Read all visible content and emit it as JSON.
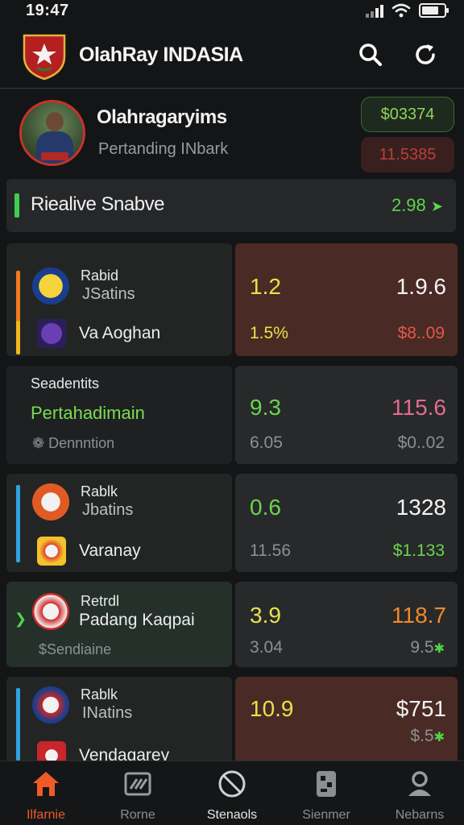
{
  "status": {
    "time": "19:47"
  },
  "header": {
    "title": "OlahRay INDASIA",
    "search_icon": "search-icon",
    "refresh_icon": "refresh-icon"
  },
  "profile": {
    "name": "Olahragaryims",
    "subtitle": "Pertanding INbark",
    "balance": "$03374",
    "loss": "11.5385",
    "colors": {
      "balance": "#8fd35e",
      "loss": "#b6403a"
    }
  },
  "live": {
    "title": "Riealive Snabve",
    "value": "2.98",
    "trend_icon": "arrow-up-icon"
  },
  "matches": [
    {
      "label": "Rabid",
      "team1": "JSatins",
      "team2": "Va Aoghan",
      "odd1": "1.2",
      "odd2": "1.9.6",
      "odd3": "1.5%",
      "odd4": "$8..09"
    },
    {
      "label": "Seadentits",
      "team1": "Pertahadimain",
      "team2": "Dennntion",
      "odd1": "9.3",
      "odd2": "115.6",
      "odd3": "6.05",
      "odd4": "$0..02"
    },
    {
      "label": "Rablk",
      "team1": "Jbatins",
      "team2": "Varanay",
      "odd1": "0.6",
      "odd2": "1328",
      "odd3": "11.56",
      "odd4": "$1.133"
    },
    {
      "label": "Retrdl",
      "team1": "Padang Kaqpai",
      "team2": "$Sendiaine",
      "odd1": "3.9",
      "odd2": "118.7",
      "odd3": "3.04",
      "odd4": "9.5"
    },
    {
      "label": "Rablk",
      "team1": "INatins",
      "team2": "Vendagarey",
      "odd1": "10.9",
      "odd2": "$751",
      "odd3": "",
      "odd4": "$.5"
    }
  ],
  "nav": [
    {
      "label": "Ilfarnie",
      "icon": "home-icon"
    },
    {
      "label": "Rorne",
      "icon": "ticket-icon"
    },
    {
      "label": "Stenaols",
      "icon": "ball-icon"
    },
    {
      "label": "Sienmer",
      "icon": "wallet-icon"
    },
    {
      "label": "Nebarns",
      "icon": "profile-icon"
    }
  ]
}
